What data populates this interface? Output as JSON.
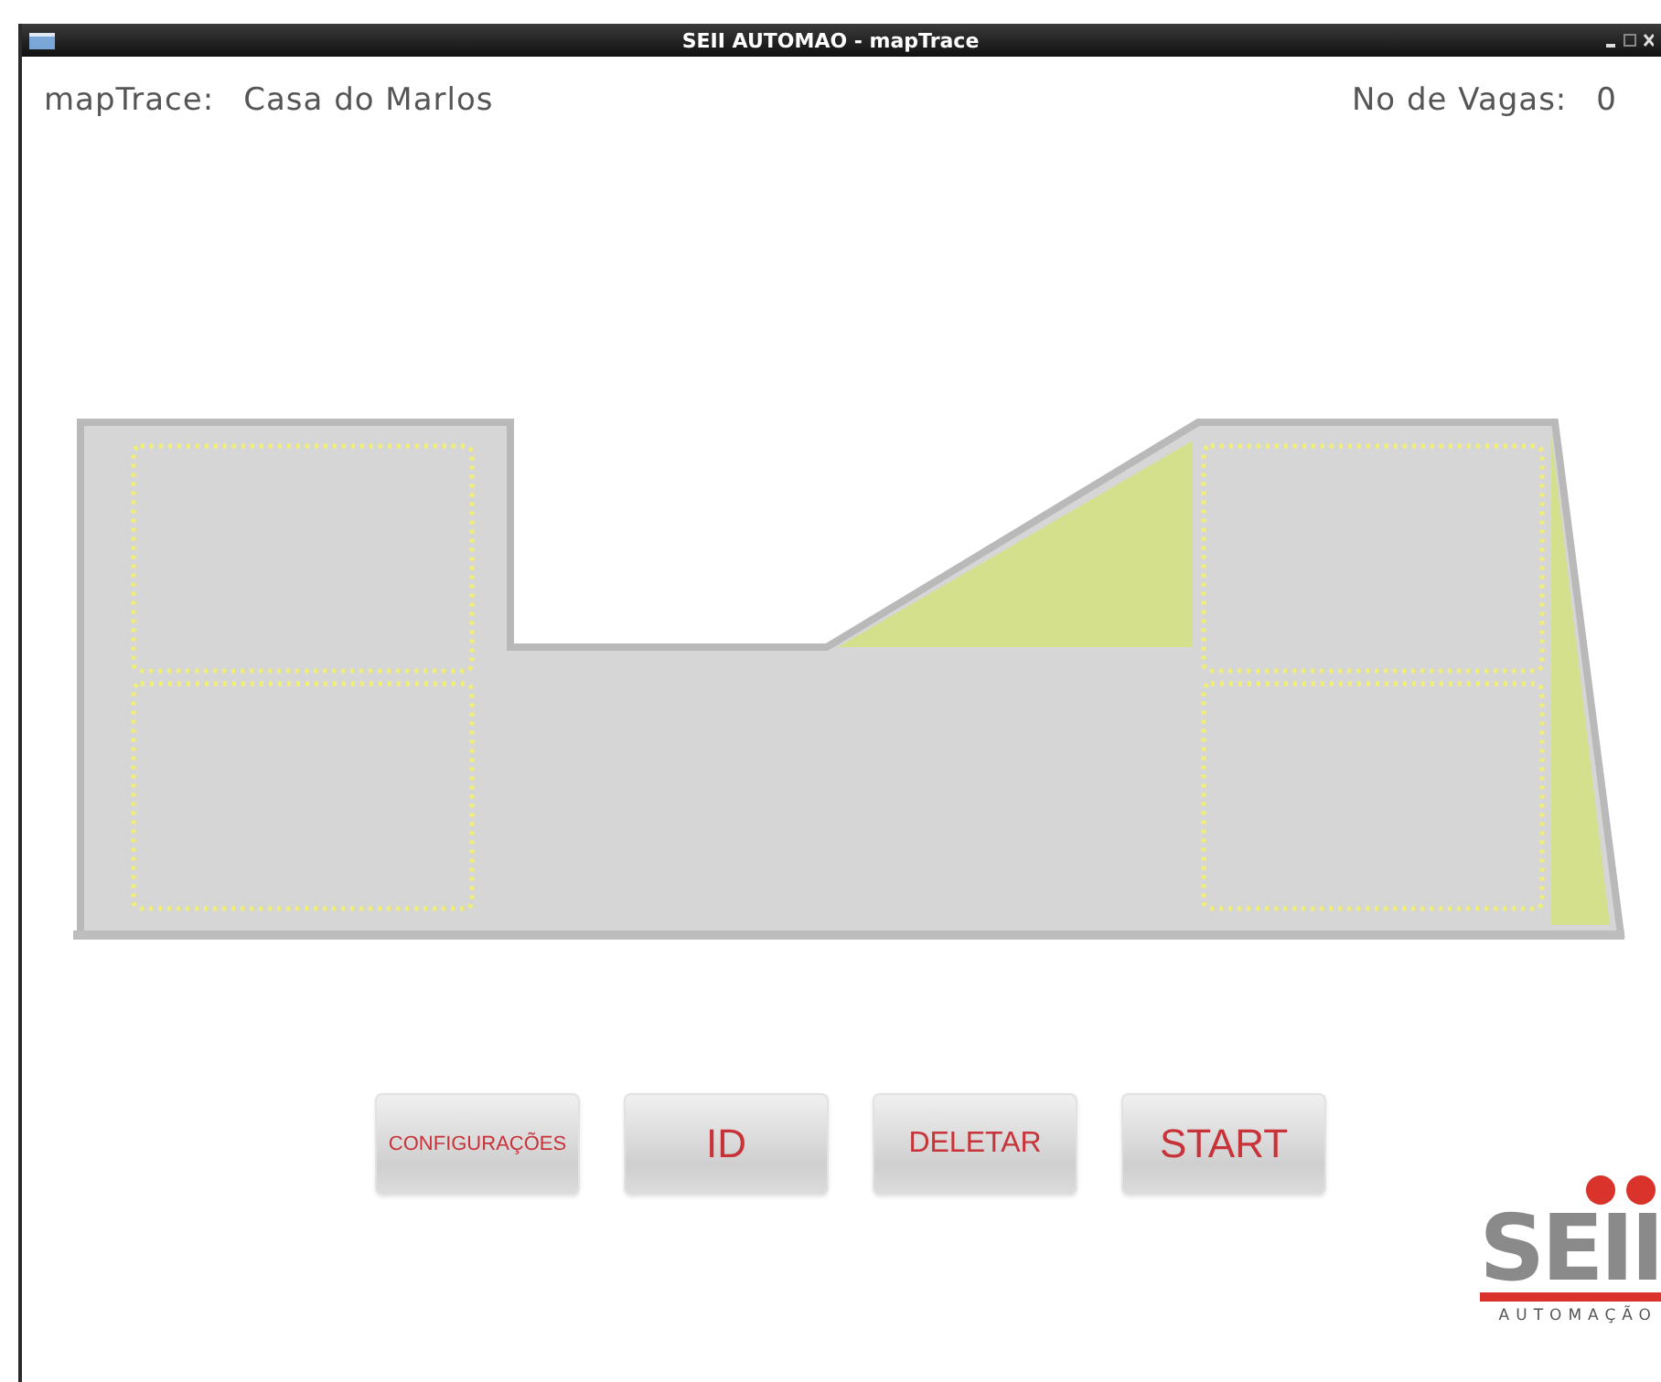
{
  "window": {
    "title": "SEII AUTOMAO - mapTrace"
  },
  "header": {
    "map_label": "mapTrace:",
    "map_name": "Casa do Marlos",
    "spots_label": "No de Vagas:",
    "spots_count": "0"
  },
  "buttons": [
    "CONFIGURAÇÕES",
    "ID",
    "DELETAR",
    "START"
  ],
  "logo": {
    "name": "SEII",
    "tagline": "AUTOMAÇÃO"
  }
}
